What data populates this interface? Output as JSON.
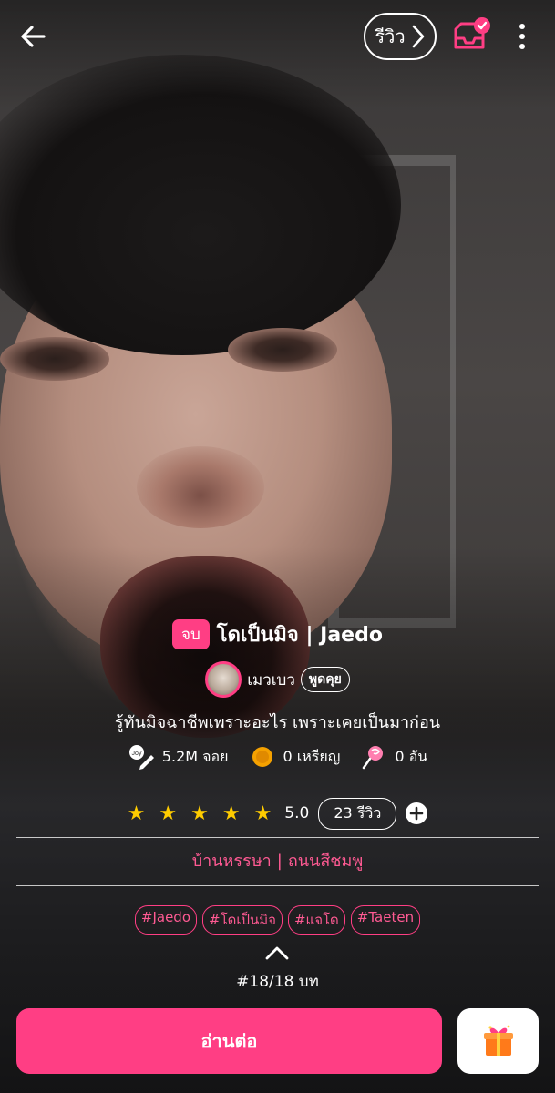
{
  "topbar": {
    "back_icon": "arrow-left-icon",
    "review_label": "รีวิว",
    "library_icon": "inbox-check-icon",
    "more_icon": "vertical-dots-icon"
  },
  "story": {
    "status": "จบ",
    "title": "โดเป็นมิจ | Jaedo",
    "author": "เมวเบว",
    "talk_label": "พูดคุย",
    "tagline": "รู้ทันมิจฉาชีพเพราะอะไร เพราะเคยเป็นมาก่อน",
    "stats": {
      "reads": "5.2M จอย",
      "coins": "0 เหรียญ",
      "lollipops": "0 อัน"
    },
    "rating": {
      "stars": 5,
      "value": "5.0",
      "reviews": "23 รีวิว"
    },
    "category": "บ้านหรรษา",
    "sub_category": "ถนนสีชมพู",
    "tags": [
      "#Jaedo",
      "#โดเป็นมิจ",
      "#แจโด",
      "#Taeten"
    ],
    "episode": "#18/18 บท"
  },
  "actions": {
    "read_label": "อ่านต่อ",
    "gift_icon": "gift-icon"
  },
  "colors": {
    "accent": "#ff3e84",
    "star": "#ffcc00"
  }
}
